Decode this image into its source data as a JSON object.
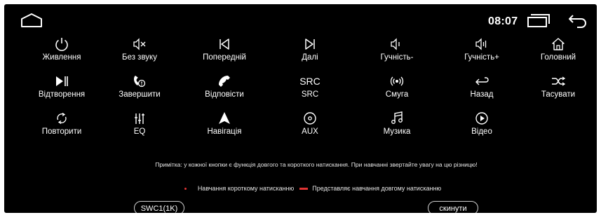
{
  "status_bar": {
    "time": "08:07"
  },
  "keys": [
    {
      "label": "Живлення",
      "icon": "power-icon"
    },
    {
      "label": "Без звуку",
      "icon": "mute-icon"
    },
    {
      "label": "Попередній",
      "icon": "previous-track-icon"
    },
    {
      "label": "Далі",
      "icon": "next-track-icon"
    },
    {
      "label": "Гучність-",
      "icon": "volume-down-icon"
    },
    {
      "label": "Гучність+",
      "icon": "volume-up-icon"
    },
    {
      "label": "Головний",
      "icon": "home-icon"
    },
    {
      "label": "Відтворення",
      "icon": "play-pause-icon"
    },
    {
      "label": "Завершити",
      "icon": "hang-up-icon"
    },
    {
      "label": "Відповісти",
      "icon": "answer-call-icon"
    },
    {
      "label": "SRC",
      "icon": "src-text-icon",
      "icon_text": "SRC"
    },
    {
      "label": "Смуга",
      "icon": "radio-band-icon"
    },
    {
      "label": "Назад",
      "icon": "return-icon"
    },
    {
      "label": "Тасувати",
      "icon": "shuffle-icon"
    },
    {
      "label": "Повторити",
      "icon": "repeat-icon"
    },
    {
      "label": "EQ",
      "icon": "equalizer-icon"
    },
    {
      "label": "Навігація",
      "icon": "navigation-icon"
    },
    {
      "label": "AUX",
      "icon": "aux-icon"
    },
    {
      "label": "Музика",
      "icon": "music-icon"
    },
    {
      "label": "Відео",
      "icon": "video-icon"
    }
  ],
  "note": "Примітка: у кожної кнопки є функція довгого та короткого натискання. При навчанні звертайте увагу на цю різницю!",
  "legend": {
    "short": "Навчання короткому натисканню",
    "long": "Представляє навчання довгому натисканню",
    "color": "#e23434"
  },
  "buttons": {
    "swc": "SWC1(1K)",
    "reset": "скинути"
  }
}
